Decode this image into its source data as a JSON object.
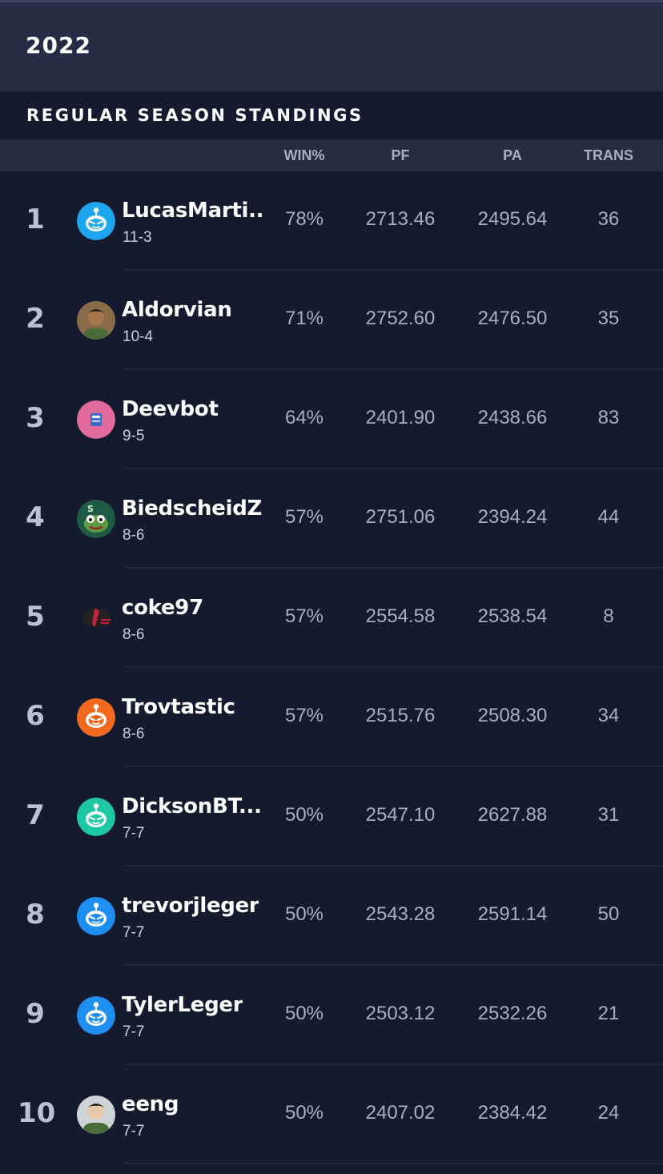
{
  "header": {
    "year": "2022"
  },
  "section": {
    "title": "REGULAR SEASON STANDINGS"
  },
  "columns": {
    "win_pct": "WIN%",
    "pf": "PF",
    "pa": "PA",
    "trans": "TRANS"
  },
  "standings": [
    {
      "rank": "1",
      "name": "LucasMarti...",
      "record": "11-3",
      "win_pct": "78%",
      "pf": "2713.46",
      "pa": "2495.64",
      "trans": "36",
      "avatar": "robot-blue-icon",
      "color": "#1fa6f0"
    },
    {
      "rank": "2",
      "name": "Aldorvian",
      "record": "10-4",
      "win_pct": "71%",
      "pf": "2752.60",
      "pa": "2476.50",
      "trans": "35",
      "avatar": "user-photo-avatar",
      "color": "#8a6b4a"
    },
    {
      "rank": "3",
      "name": "Deevbot",
      "record": "9-5",
      "win_pct": "64%",
      "pf": "2401.90",
      "pa": "2438.66",
      "trans": "83",
      "avatar": "logo-pink-avatar",
      "color": "#e26a9a"
    },
    {
      "rank": "4",
      "name": "BiedscheidZ",
      "record": "8-6",
      "win_pct": "57%",
      "pf": "2751.06",
      "pa": "2394.24",
      "trans": "44",
      "avatar": "frog-avatar",
      "color": "#2f7a5a"
    },
    {
      "rank": "5",
      "name": "coke97",
      "record": "8-6",
      "win_pct": "57%",
      "pf": "2554.58",
      "pa": "2538.54",
      "trans": "8",
      "avatar": "helmet-avatar",
      "color": "#c0243a"
    },
    {
      "rank": "6",
      "name": "Trovtastic",
      "record": "8-6",
      "win_pct": "57%",
      "pf": "2515.76",
      "pa": "2508.30",
      "trans": "34",
      "avatar": "robot-orange-icon",
      "color": "#f26a1f"
    },
    {
      "rank": "7",
      "name": "DicksonBT...",
      "record": "7-7",
      "win_pct": "50%",
      "pf": "2547.10",
      "pa": "2627.88",
      "trans": "31",
      "avatar": "robot-teal-icon",
      "color": "#1dc9a4"
    },
    {
      "rank": "8",
      "name": "trevorjleger",
      "record": "7-7",
      "win_pct": "50%",
      "pf": "2543.28",
      "pa": "2591.14",
      "trans": "50",
      "avatar": "robot-blue-icon",
      "color": "#1e8ff0"
    },
    {
      "rank": "9",
      "name": "TylerLeger",
      "record": "7-7",
      "win_pct": "50%",
      "pf": "2503.12",
      "pa": "2532.26",
      "trans": "21",
      "avatar": "robot-blue-icon",
      "color": "#1e8ff0"
    },
    {
      "rank": "10",
      "name": "eeng",
      "record": "7-7",
      "win_pct": "50%",
      "pf": "2407.02",
      "pa": "2384.42",
      "trans": "24",
      "avatar": "user-photo-avatar",
      "color": "#d9d9d9"
    }
  ]
}
